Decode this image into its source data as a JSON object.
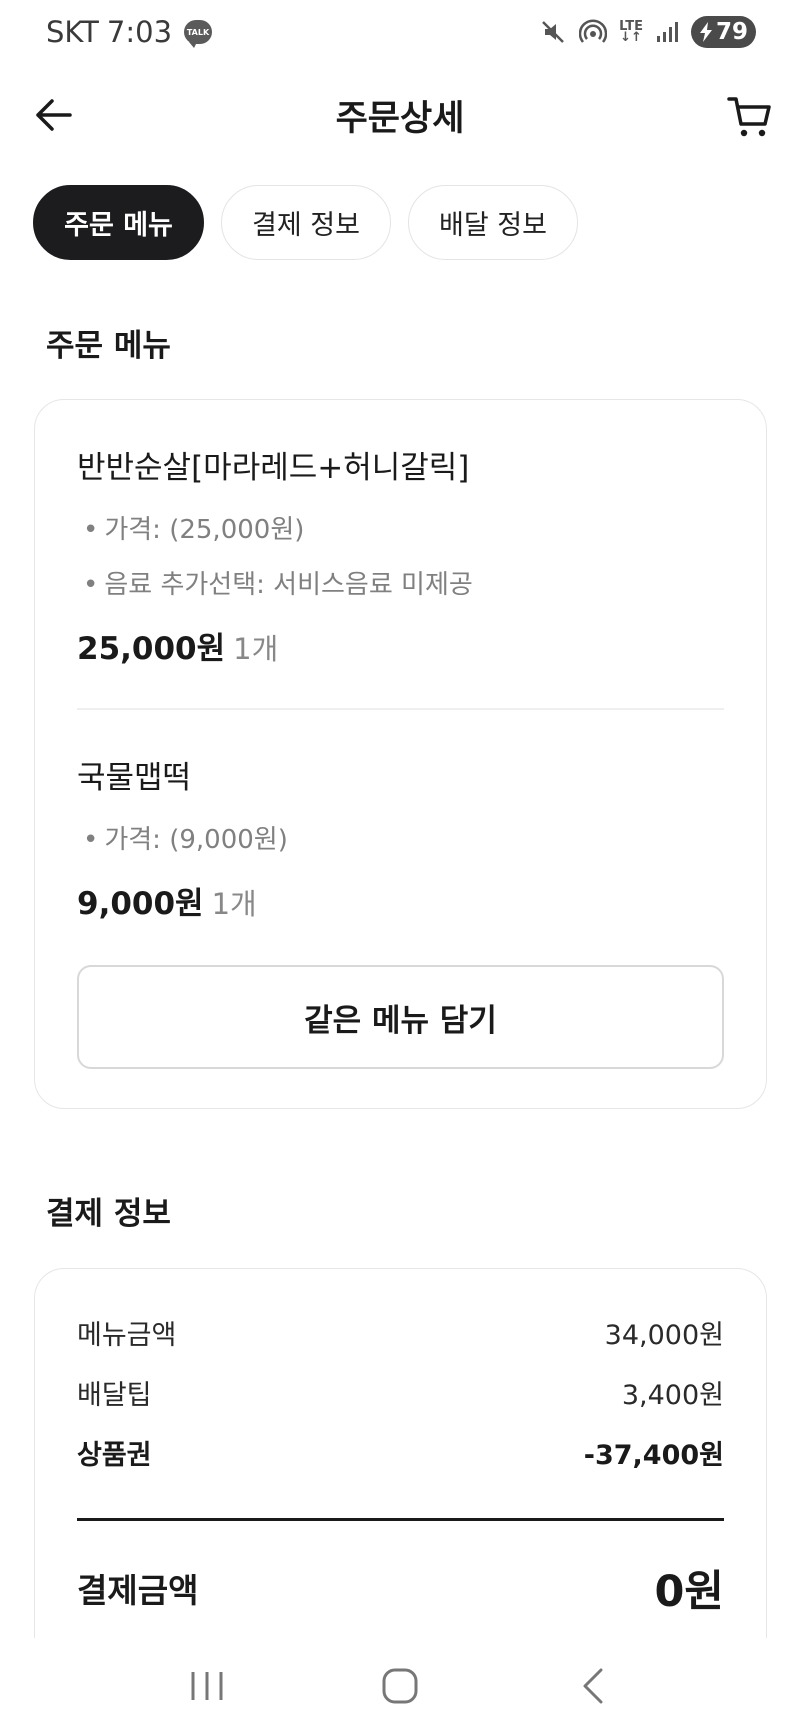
{
  "status_bar": {
    "carrier": "SKT",
    "time": "7:03",
    "talk_label": "TALK",
    "network": "LTE",
    "battery": "79"
  },
  "header": {
    "title": "주문상세"
  },
  "tabs": [
    {
      "label": "주문 메뉴",
      "active": true
    },
    {
      "label": "결제 정보",
      "active": false
    },
    {
      "label": "배달 정보",
      "active": false
    }
  ],
  "order_section": {
    "title": "주문 메뉴",
    "items": [
      {
        "name": "반반순살[마라레드+허니갈릭]",
        "options": [
          "가격: (25,000원)",
          "음료 추가선택: 서비스음료 미제공"
        ],
        "price": "25,000원",
        "quantity": "1개"
      },
      {
        "name": "국물맵떡",
        "options": [
          "가격: (9,000원)"
        ],
        "price": "9,000원",
        "quantity": "1개"
      }
    ],
    "same_menu_button": "같은 메뉴 담기"
  },
  "payment_section": {
    "title": "결제 정보",
    "rows": [
      {
        "label": "메뉴금액",
        "value": "34,000원"
      },
      {
        "label": "배달팁",
        "value": "3,400원"
      },
      {
        "label": "상품권",
        "value": "-37,400원"
      }
    ],
    "total_label": "결제금액",
    "total_value": "0원"
  },
  "icons": {
    "back": "arrow-left-icon",
    "cart": "cart-icon",
    "mute": "mute-icon",
    "hotspot": "hotspot-icon",
    "signal": "signal-icon",
    "battery": "battery-charging-icon",
    "nav_recent": "recent-apps-icon",
    "nav_home": "home-icon",
    "nav_back": "nav-back-icon"
  },
  "colors": {
    "active_tab_bg": "#1c1c1e",
    "muted_text": "#808080",
    "border": "#e6e6e6"
  }
}
